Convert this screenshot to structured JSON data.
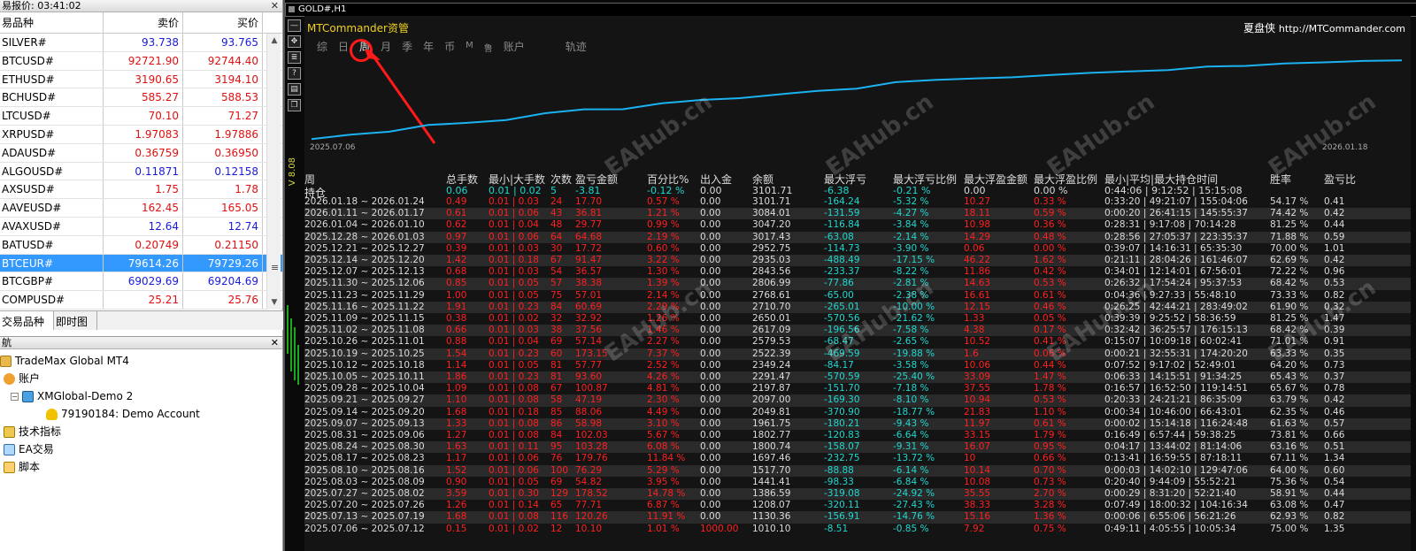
{
  "market_watch": {
    "title": "易报价: 03:41:02",
    "columns": [
      "易品种",
      "卖价",
      "买价"
    ],
    "rows": [
      {
        "symbol": "SILVER#",
        "bid": "93.738",
        "ask": "93.765",
        "color": "blue"
      },
      {
        "symbol": "BTCUSD#",
        "bid": "92721.90",
        "ask": "92744.40",
        "color": "red"
      },
      {
        "symbol": "ETHUSD#",
        "bid": "3190.65",
        "ask": "3194.10",
        "color": "red"
      },
      {
        "symbol": "BCHUSD#",
        "bid": "585.27",
        "ask": "588.53",
        "color": "red"
      },
      {
        "symbol": "LTCUSD#",
        "bid": "70.10",
        "ask": "71.27",
        "color": "red"
      },
      {
        "symbol": "XRPUSD#",
        "bid": "1.97083",
        "ask": "1.97886",
        "color": "red"
      },
      {
        "symbol": "ADAUSD#",
        "bid": "0.36759",
        "ask": "0.36950",
        "color": "red"
      },
      {
        "symbol": "ALGOUSD#",
        "bid": "0.11871",
        "ask": "0.12158",
        "color": "blue"
      },
      {
        "symbol": "AXSUSD#",
        "bid": "1.75",
        "ask": "1.78",
        "color": "red"
      },
      {
        "symbol": "AAVEUSD#",
        "bid": "162.45",
        "ask": "165.05",
        "color": "red"
      },
      {
        "symbol": "AVAXUSD#",
        "bid": "12.64",
        "ask": "12.74",
        "color": "blue"
      },
      {
        "symbol": "BATUSD#",
        "bid": "0.20749",
        "ask": "0.21150",
        "color": "red"
      },
      {
        "symbol": "BTCEUR#",
        "bid": "79614.26",
        "ask": "79729.26",
        "color": "selected"
      },
      {
        "symbol": "BTCGBP#",
        "bid": "69029.69",
        "ask": "69204.69",
        "color": "blue"
      },
      {
        "symbol": "COMPUSD#",
        "bid": "25.21",
        "ask": "25.76",
        "color": "red"
      }
    ],
    "tabs": [
      "交易品种",
      "即时图"
    ]
  },
  "navigator": {
    "title": "航",
    "items": {
      "broker": "TradeMax Global MT4",
      "accounts": "账户",
      "server": "XMGlobal-Demo 2",
      "account": "79190184: Demo Account",
      "indicators": "技术指标",
      "ea": "EA交易",
      "scripts": "脚本"
    }
  },
  "chart": {
    "window_title": "GOLD#,H1",
    "app_title": "MTCommander资管",
    "brand_cn": "夏盘侠",
    "brand_url": "http://MTCommander.com",
    "tabs": [
      "综",
      "日",
      "周",
      "月",
      "季",
      "年",
      "币",
      "M",
      "鲁",
      "账户",
      "轨迹"
    ],
    "active_tab": "周",
    "vertical_label": "V 8.08",
    "date_start": "2025.07.06",
    "date_end": "2026.01.18",
    "equity_curve": [
      [
        0,
        1010.1
      ],
      [
        1,
        1130.36
      ],
      [
        2,
        1208.07
      ],
      [
        3,
        1386.59
      ],
      [
        4,
        1441.41
      ],
      [
        5,
        1517.7
      ],
      [
        6,
        1697.46
      ],
      [
        7,
        1800.74
      ],
      [
        8,
        1802.77
      ],
      [
        9,
        1961.75
      ],
      [
        10,
        2049.81
      ],
      [
        11,
        2097.0
      ],
      [
        12,
        2197.87
      ],
      [
        13,
        2291.47
      ],
      [
        14,
        2349.24
      ],
      [
        15,
        2522.39
      ],
      [
        16,
        2579.53
      ],
      [
        17,
        2617.09
      ],
      [
        18,
        2650.01
      ],
      [
        19,
        2710.7
      ],
      [
        20,
        2768.61
      ],
      [
        21,
        2806.99
      ],
      [
        22,
        2843.56
      ],
      [
        23,
        2935.03
      ],
      [
        24,
        2952.75
      ],
      [
        25,
        3017.43
      ],
      [
        26,
        3047.2
      ],
      [
        27,
        3084.01
      ],
      [
        28,
        3101.71
      ]
    ]
  },
  "table": {
    "headers": {
      "period": "周",
      "lots": "总手数",
      "minmax": "最小|大手数",
      "count": "次数",
      "pnl": "盈亏金额",
      "pct": "百分比%",
      "flow": "出入金",
      "balance": "余额",
      "max_dd": "最大浮亏",
      "max_dd_pct": "最大浮亏比例",
      "max_fp": "最大浮盈金额",
      "max_fp_pct": "最大浮盈比例",
      "hold": "最小|平均|最大持仓时间",
      "winrate": "胜率",
      "ratio": "盈亏比"
    },
    "summary": {
      "label": "持仓",
      "lots": "0.06",
      "minmax": "0.01 | 0.02",
      "count": "5",
      "pnl": "-3.81",
      "pct": "-0.12 %",
      "flow": "0.00",
      "balance": "3101.71",
      "max_dd": "-6.38",
      "max_dd_pct": "-0.21 %",
      "max_fp": "0.00",
      "max_fp_pct": "0.00 %",
      "hold": "0:44:06 | 9:12:52 | 15:15:08"
    },
    "rows": [
      [
        "2026.01.18 ~ 2026.01.24",
        "0.49",
        "0.01 | 0.03",
        "24",
        "17.70",
        "0.57 %",
        "0.00",
        "3101.71",
        "-164.24",
        "-5.32 %",
        "10.27",
        "0.33 %",
        "0:33:20 | 49:21:07 | 155:04:06",
        "54.17 %",
        "0.41"
      ],
      [
        "2026.01.11 ~ 2026.01.17",
        "0.61",
        "0.01 | 0.06",
        "43",
        "36.81",
        "1.21 %",
        "0.00",
        "3084.01",
        "-131.59",
        "-4.27 %",
        "18.11",
        "0.59 %",
        "0:00:20 | 26:41:15 | 145:55:37",
        "74.42 %",
        "0.42"
      ],
      [
        "2026.01.04 ~ 2026.01.10",
        "0.62",
        "0.01 | 0.04",
        "48",
        "29.77",
        "0.99 %",
        "0.00",
        "3047.20",
        "-116.84",
        "-3.84 %",
        "10.98",
        "0.36 %",
        "0:28:31 | 9:17:08 | 70:14:28",
        "81.25 %",
        "0.44"
      ],
      [
        "2025.12.28 ~ 2026.01.03",
        "0.97",
        "0.01 | 0.06",
        "64",
        "64.68",
        "2.19 %",
        "0.00",
        "3017.43",
        "-63.08",
        "-2.14 %",
        "14.29",
        "0.48 %",
        "0:28:56 | 27:05:37 | 223:35:37",
        "71.88 %",
        "0.59"
      ],
      [
        "2025.12.21 ~ 2025.12.27",
        "0.39",
        "0.01 | 0.03",
        "30",
        "17.72",
        "0.60 %",
        "0.00",
        "2952.75",
        "-114.73",
        "-3.90 %",
        "0.06",
        "0.00 %",
        "0:39:07 | 14:16:31 | 65:35:30",
        "70.00 %",
        "1.01"
      ],
      [
        "2025.12.14 ~ 2025.12.20",
        "1.42",
        "0.01 | 0.18",
        "67",
        "91.47",
        "3.22 %",
        "0.00",
        "2935.03",
        "-488.49",
        "-17.15 %",
        "46.22",
        "1.62 %",
        "0:21:11 | 28:04:26 | 161:46:07",
        "62.69 %",
        "0.42"
      ],
      [
        "2025.12.07 ~ 2025.12.13",
        "0.68",
        "0.01 | 0.03",
        "54",
        "36.57",
        "1.30 %",
        "0.00",
        "2843.56",
        "-233.37",
        "-8.22 %",
        "11.86",
        "0.42 %",
        "0:34:01 | 12:14:01 | 67:56:01",
        "72.22 %",
        "0.96"
      ],
      [
        "2025.11.30 ~ 2025.12.06",
        "0.85",
        "0.01 | 0.05",
        "57",
        "38.38",
        "1.39 %",
        "0.00",
        "2806.99",
        "-77.86",
        "-2.81 %",
        "14.63",
        "0.53 %",
        "0:26:32 | 17:54:24 | 95:37:53",
        "68.42 %",
        "0.53"
      ],
      [
        "2025.11.23 ~ 2025.11.29",
        "1.00",
        "0.01 | 0.05",
        "75",
        "57.01",
        "2.14 %",
        "0.00",
        "2768.61",
        "-65.00",
        "-2.38 %",
        "16.61",
        "0.61 %",
        "0:04:36 | 9:27:33 | 55:48:10",
        "73.33 %",
        "0.82"
      ],
      [
        "2025.11.16 ~ 2025.11.22",
        "1.91",
        "0.01 | 0.23",
        "84",
        "60.69",
        "2.29 %",
        "0.00",
        "2710.70",
        "-265.01",
        "-10.00 %",
        "12.15",
        "0.46 %",
        "0:26:25 | 42:44:21 | 283:49:02",
        "61.90 %",
        "0.32"
      ],
      [
        "2025.11.09 ~ 2025.11.15",
        "0.38",
        "0.01 | 0.02",
        "32",
        "32.92",
        "1.26 %",
        "0.00",
        "2650.01",
        "-570.56",
        "-21.62 %",
        "1.33",
        "0.05 %",
        "0:39:39 | 9:25:52 | 58:36:59",
        "81.25 %",
        "1.47"
      ],
      [
        "2025.11.02 ~ 2025.11.08",
        "0.66",
        "0.01 | 0.03",
        "38",
        "37.56",
        "1.46 %",
        "0.00",
        "2617.09",
        "-196.56",
        "-7.58 %",
        "4.38",
        "0.17 %",
        "0:32:42 | 36:25:57 | 176:15:13",
        "68.42 %",
        "0.39"
      ],
      [
        "2025.10.26 ~ 2025.11.01",
        "0.88",
        "0.01 | 0.04",
        "69",
        "57.14",
        "2.27 %",
        "0.00",
        "2579.53",
        "-68.47",
        "-2.65 %",
        "10.52",
        "0.41 %",
        "0:15:07 | 10:09:18 | 60:02:41",
        "71.01 %",
        "0.91"
      ],
      [
        "2025.10.19 ~ 2025.10.25",
        "1.54",
        "0.01 | 0.23",
        "60",
        "173.15",
        "7.37 %",
        "0.00",
        "2522.39",
        "-469.59",
        "-19.88 %",
        "1.6",
        "0.06 %",
        "0:00:21 | 32:55:31 | 174:20:20",
        "63.33 %",
        "0.35"
      ],
      [
        "2025.10.12 ~ 2025.10.18",
        "1.14",
        "0.01 | 0.05",
        "81",
        "57.77",
        "2.52 %",
        "0.00",
        "2349.24",
        "-84.17",
        "-3.58 %",
        "10.06",
        "0.44 %",
        "0:07:52 | 9:17:02 | 52:49:01",
        "64.20 %",
        "0.73"
      ],
      [
        "2025.10.05 ~ 2025.10.11",
        "1.86",
        "0.01 | 0.23",
        "81",
        "93.60",
        "4.26 %",
        "0.00",
        "2291.47",
        "-570.59",
        "-25.40 %",
        "33.09",
        "1.47 %",
        "0:06:33 | 14:15:51 | 91:34:25",
        "65.43 %",
        "0.37"
      ],
      [
        "2025.09.28 ~ 2025.10.04",
        "1.09",
        "0.01 | 0.08",
        "67",
        "100.87",
        "4.81 %",
        "0.00",
        "2197.87",
        "-151.70",
        "-7.18 %",
        "37.55",
        "1.78 %",
        "0:16:57 | 16:52:50 | 119:14:51",
        "65.67 %",
        "0.78"
      ],
      [
        "2025.09.21 ~ 2025.09.27",
        "1.10",
        "0.01 | 0.08",
        "58",
        "47.19",
        "2.30 %",
        "0.00",
        "2097.00",
        "-169.30",
        "-8.10 %",
        "10.94",
        "0.53 %",
        "0:20:33 | 24:21:21 | 86:35:09",
        "63.79 %",
        "0.42"
      ],
      [
        "2025.09.14 ~ 2025.09.20",
        "1.68",
        "0.01 | 0.18",
        "85",
        "88.06",
        "4.49 %",
        "0.00",
        "2049.81",
        "-370.90",
        "-18.77 %",
        "21.83",
        "1.10 %",
        "0:00:34 | 10:46:00 | 66:43:01",
        "62.35 %",
        "0.46"
      ],
      [
        "2025.09.07 ~ 2025.09.13",
        "1.33",
        "0.01 | 0.08",
        "86",
        "58.98",
        "3.10 %",
        "0.00",
        "1961.75",
        "-180.21",
        "-9.43 %",
        "11.97",
        "0.61 %",
        "0:00:02 | 15:14:18 | 116:24:48",
        "61.63 %",
        "0.57"
      ],
      [
        "2025.08.31 ~ 2025.09.06",
        "1.27",
        "0.01 | 0.08",
        "84",
        "102.03",
        "5.67 %",
        "0.00",
        "1802.77",
        "-120.83",
        "-6.64 %",
        "33.15",
        "1.79 %",
        "0:16:49 | 6:57:44 | 59:38:25",
        "73.81 %",
        "0.66"
      ],
      [
        "2025.08.24 ~ 2025.08.30",
        "1.63",
        "0.01 | 0.11",
        "95",
        "103.28",
        "6.08 %",
        "0.00",
        "1800.74",
        "-158.07",
        "-9.31 %",
        "16.07",
        "0.95 %",
        "0:04:17 | 13:44:02 | 81:14:06",
        "63.16 %",
        "0.51"
      ],
      [
        "2025.08.17 ~ 2025.08.23",
        "1.17",
        "0.01 | 0.06",
        "76",
        "179.76",
        "11.84 %",
        "0.00",
        "1697.46",
        "-232.75",
        "-13.72 %",
        "10",
        "0.66 %",
        "0:13:41 | 16:59:55 | 87:18:11",
        "67.11 %",
        "1.34"
      ],
      [
        "2025.08.10 ~ 2025.08.16",
        "1.52",
        "0.01 | 0.06",
        "100",
        "76.29",
        "5.29 %",
        "0.00",
        "1517.70",
        "-88.88",
        "-6.14 %",
        "10.14",
        "0.70 %",
        "0:00:03 | 14:02:10 | 129:47:06",
        "64.00 %",
        "0.60"
      ],
      [
        "2025.08.03 ~ 2025.08.09",
        "0.90",
        "0.01 | 0.05",
        "69",
        "54.82",
        "3.95 %",
        "0.00",
        "1441.41",
        "-98.33",
        "-6.84 %",
        "10.08",
        "0.73 %",
        "0:20:40 | 9:44:09 | 55:52:21",
        "75.36 %",
        "0.54"
      ],
      [
        "2025.07.27 ~ 2025.08.02",
        "3.59",
        "0.01 | 0.30",
        "129",
        "178.52",
        "14.78 %",
        "0.00",
        "1386.59",
        "-319.08",
        "-24.92 %",
        "35.55",
        "2.70 %",
        "0:00:29 | 8:31:20 | 52:21:40",
        "58.91 %",
        "0.44"
      ],
      [
        "2025.07.20 ~ 2025.07.26",
        "1.26",
        "0.01 | 0.14",
        "65",
        "77.71",
        "6.87 %",
        "0.00",
        "1208.07",
        "-320.11",
        "-27.43 %",
        "38.33",
        "3.28 %",
        "0:07:49 | 18:00:32 | 104:16:34",
        "63.08 %",
        "0.47"
      ],
      [
        "2025.07.13 ~ 2025.07.19",
        "1.68",
        "0.01 | 0.08",
        "116",
        "120.26",
        "11.91 %",
        "0.00",
        "1130.36",
        "-156.91",
        "-14.76 %",
        "15.16",
        "1.36 %",
        "0:00:06 | 6:55:06 | 56:21:26",
        "62.93 %",
        "0.82"
      ],
      [
        "2025.07.06 ~ 2025.07.12",
        "0.15",
        "0.01 | 0.02",
        "12",
        "10.10",
        "1.01 %",
        "1000.00",
        "1010.10",
        "-8.51",
        "-0.85 %",
        "7.92",
        "0.75 %",
        "0:49:11 | 4:05:55 | 10:05:34",
        "75.00 %",
        "1.35"
      ]
    ]
  },
  "watermark": "EAHub.cn"
}
